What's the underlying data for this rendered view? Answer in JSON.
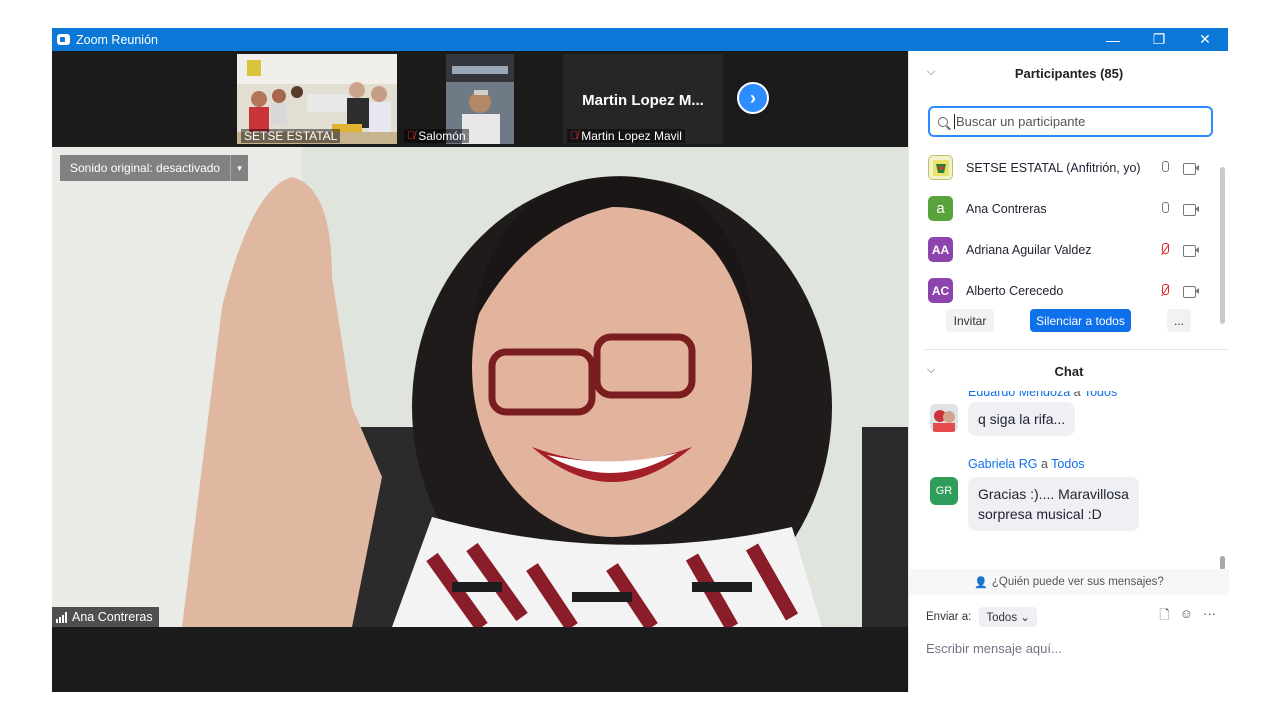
{
  "window": {
    "title": "Zoom Reunión",
    "controls": {
      "minimize": "—",
      "restore": "❐",
      "close": "✕"
    }
  },
  "thumbnails": [
    {
      "name": "SETSE ESTATAL",
      "muted": false
    },
    {
      "name": "Salomón",
      "muted": true
    },
    {
      "name": "Martin Lopez Mavil",
      "display_name": "Martin Lopez M...",
      "muted": true
    }
  ],
  "next_page_icon": "chevron-right-icon",
  "main_video": {
    "sound_button": "Sonido original: desactivado",
    "speaker_name": "Ana Contreras"
  },
  "participants": {
    "title": "Participantes (85)",
    "search_placeholder": "Buscar un participante",
    "list": [
      {
        "name": "SETSE ESTATAL (Anfitrión, yo)",
        "initials": "",
        "color": "#9bbd3a",
        "mic_muted": false
      },
      {
        "name": "Ana Contreras",
        "initials": "a",
        "color": "#5aa33c",
        "mic_muted": false
      },
      {
        "name": "Adriana Aguilar Valdez",
        "initials": "AA",
        "color": "#8e44ad",
        "mic_muted": true
      },
      {
        "name": "Alberto Cerecedo",
        "initials": "AC",
        "color": "#8e44ad",
        "mic_muted": true
      }
    ],
    "buttons": {
      "invite": "Invitar",
      "mute_all": "Silenciar a todos",
      "more": "..."
    }
  },
  "chat": {
    "title": "Chat",
    "messages": [
      {
        "sender": "Eduardo Mendoza",
        "to_word": "a",
        "recipient": "Todos",
        "text": "q siga la rifa..."
      },
      {
        "sender": "Gabriela RG",
        "to_word": "a",
        "recipient": "Todos",
        "initials": "GR",
        "text_line1": "Gracias :).... Maravillosa",
        "text_line2": "sorpresa musical :D"
      }
    ],
    "who_can_see": "¿Quién puede ver sus mensajes?",
    "send_to_label": "Enviar a:",
    "send_to_value": "Todos",
    "compose_placeholder": "Escribir mensaje aquí..."
  },
  "colors": {
    "titlebar": "#0b78d7",
    "accent": "#2d8cff",
    "muted_red": "#e02828"
  }
}
